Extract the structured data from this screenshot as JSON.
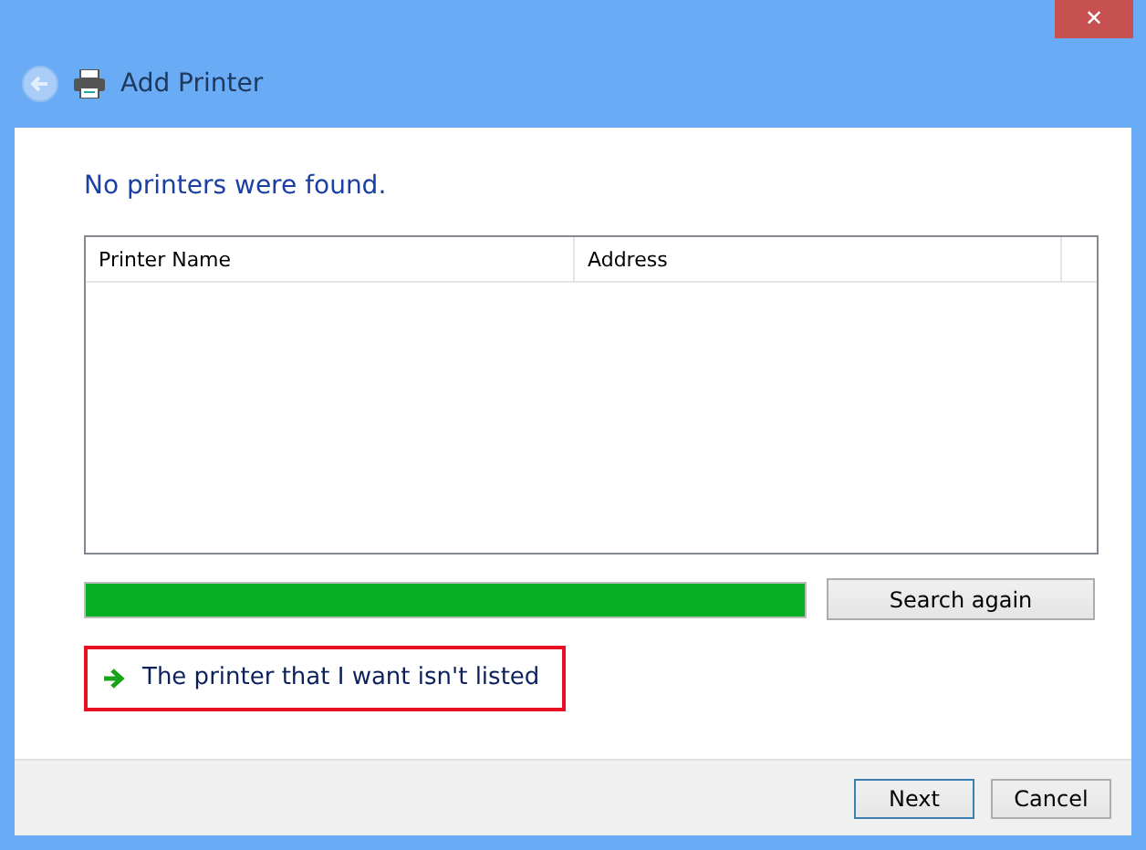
{
  "window": {
    "title": "Add Printer",
    "close": "✕",
    "back_enabled": false
  },
  "heading": "No printers were found.",
  "table": {
    "columns": [
      "Printer Name",
      "Address"
    ]
  },
  "progress": {
    "level": 1
  },
  "search_button": "Search again",
  "link": {
    "text": "The printer that I want isn't listed",
    "highlighted": true
  },
  "buttons": [
    {
      "label": "Next",
      "default": true
    },
    {
      "label": "Cancel",
      "default": false
    }
  ]
}
